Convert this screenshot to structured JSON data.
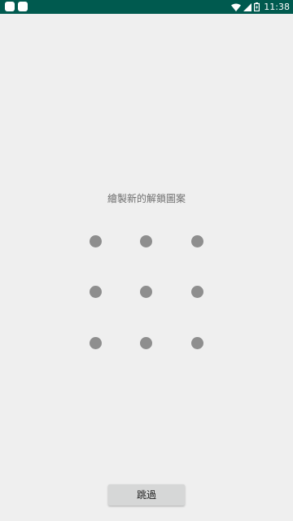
{
  "status_bar": {
    "time": "11:38",
    "background_color": "#005a4f",
    "left_icons": [
      "notification-icon",
      "notification-icon"
    ],
    "right_icons": [
      "wifi-icon",
      "cell-signal-icon",
      "battery-icon"
    ]
  },
  "main": {
    "prompt": "繪製新的解鎖圖案",
    "pattern_dots": [
      1,
      2,
      3,
      4,
      5,
      6,
      7,
      8,
      9
    ],
    "dot_color": "#8e8e8e"
  },
  "footer": {
    "skip_label": "跳過"
  }
}
